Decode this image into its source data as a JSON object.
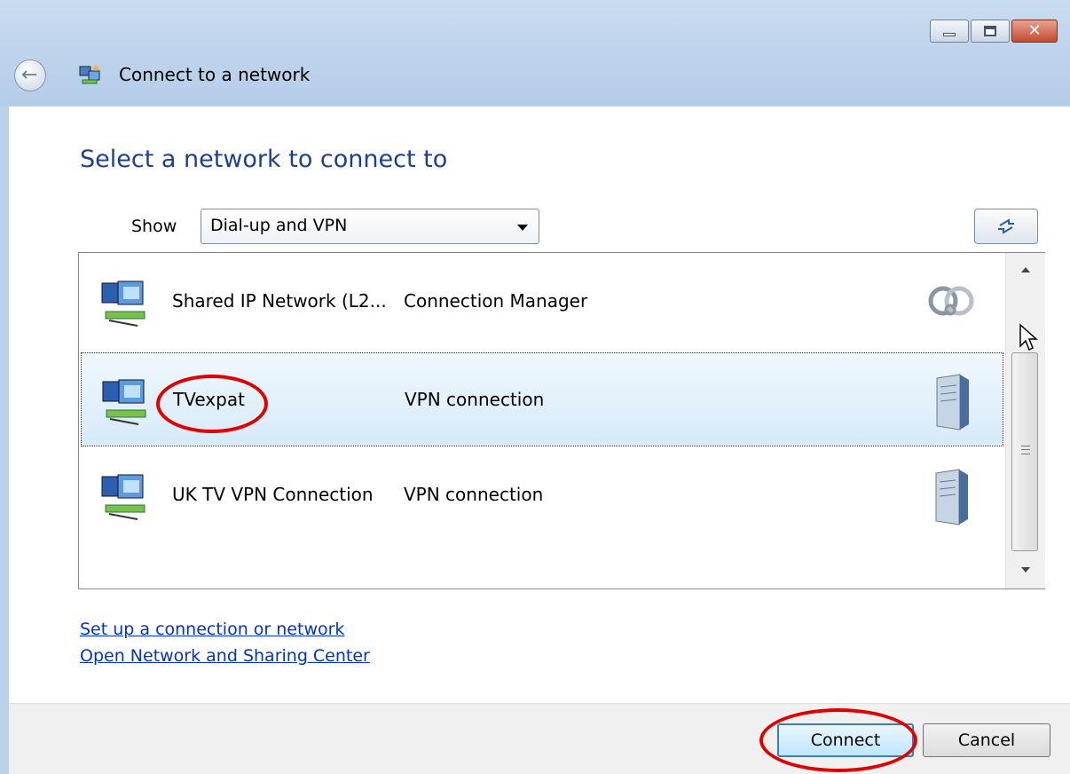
{
  "window": {
    "title": "Connect to a network",
    "controls": {
      "minimize": "minimize",
      "maximize": "maximize",
      "close": "✕"
    }
  },
  "main": {
    "heading": "Select a network to connect to",
    "show_label": "Show",
    "filter_value": "Dial-up and VPN"
  },
  "networks": [
    {
      "name": "Shared IP Network (L2...",
      "type": "Connection Manager",
      "icon": "connection-manager-icon",
      "selected": false
    },
    {
      "name": "TVexpat",
      "type": "VPN connection",
      "icon": "server-icon",
      "selected": true
    },
    {
      "name": "UK TV VPN Connection",
      "type": "VPN connection",
      "icon": "server-icon",
      "selected": false
    }
  ],
  "links": {
    "setup": "Set up a connection or network",
    "sharing_center": "Open Network and Sharing Center"
  },
  "buttons": {
    "connect": "Connect",
    "cancel": "Cancel"
  },
  "colors": {
    "heading": "#1e3f8f",
    "link": "#0033cc",
    "highlight_ring": "#e00000",
    "selection": "#d6eaf8"
  }
}
